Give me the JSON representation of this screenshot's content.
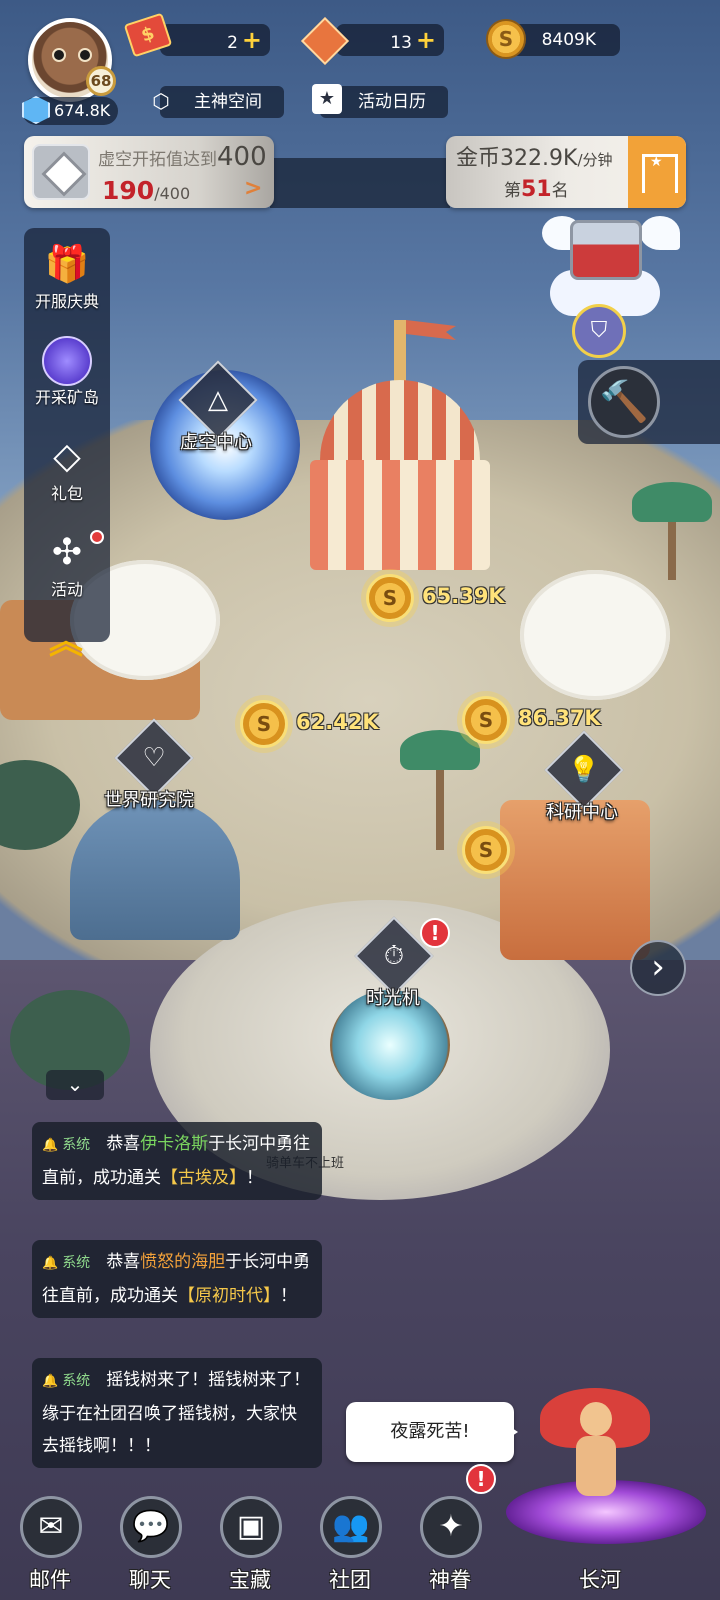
{
  "player": {
    "level": "68",
    "gems": "674.8K"
  },
  "resources": [
    {
      "icon": "red-ticket-icon",
      "value": "2"
    },
    {
      "icon": "orange-diamond-ticket-icon",
      "value": "13"
    },
    {
      "icon": "gold-coin-icon",
      "value": "8409K"
    }
  ],
  "top_buttons": {
    "god_space": "主神空间",
    "event_calendar": "活动日历"
  },
  "quest": {
    "title": "虚空开拓值达到",
    "target": "400",
    "current": "190",
    "total": "/400",
    "arrow": ">"
  },
  "gold_rate": {
    "label": "金币",
    "value": "322.9K",
    "unit": "/分钟",
    "rank_prefix": "第",
    "rank": "51",
    "rank_suffix": "名"
  },
  "side_menu": [
    {
      "label": "开服庆典",
      "icon": "gift-plant-icon"
    },
    {
      "label": "开采矿岛",
      "icon": "mining-island-icon"
    },
    {
      "label": "礼包",
      "icon": "diamond-icon"
    },
    {
      "label": "活动",
      "icon": "pinwheel-icon"
    }
  ],
  "map": {
    "void_center": "虚空中心",
    "world_research": "世界研究院",
    "research_center": "科研中心",
    "time_machine": "时光机",
    "coin_symbol": "S",
    "coins": [
      "65.39K",
      "62.42K",
      "86.37K"
    ],
    "player_name": "骑单车不上班",
    "alert_mark": "!"
  },
  "chat": {
    "toggle": "⌄",
    "messages": [
      {
        "tag": "系统",
        "pre": "恭喜",
        "name": "伊卡洛斯",
        "mid": "于长河中勇往直前，成功通关",
        "stage": "【古埃及】",
        "end": "！"
      },
      {
        "tag": "系统",
        "pre": "恭喜",
        "name": "愤怒的海胆",
        "mid": "于长河中勇往直前，成功通关",
        "stage": "【原初时代】",
        "end": "！"
      },
      {
        "tag": "系统",
        "text": "摇钱树来了！摇钱树来了！缘于在社团召唤了摇钱树，大家快去摇钱啊！！！"
      }
    ]
  },
  "speech": "夜露死苦!",
  "bottom_nav": [
    {
      "label": "邮件",
      "icon": "mail-icon"
    },
    {
      "label": "聊天",
      "icon": "chat-icon"
    },
    {
      "label": "宝藏",
      "icon": "treasure-chest-icon"
    },
    {
      "label": "社团",
      "icon": "guild-icon"
    },
    {
      "label": "神眷",
      "icon": "star-sparkle-icon"
    },
    {
      "label": "长河",
      "icon": "long-river-portal-icon"
    }
  ]
}
